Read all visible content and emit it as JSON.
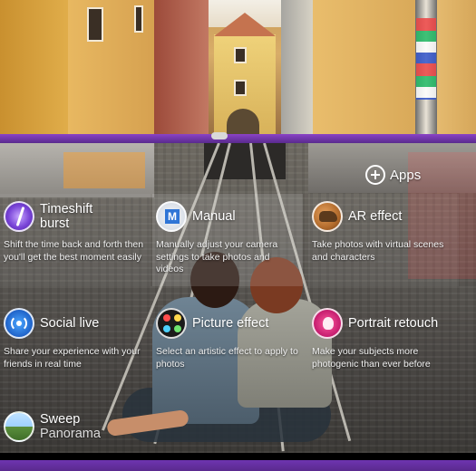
{
  "apps": {
    "label": "Apps"
  },
  "tiles": [
    {
      "title1": "Timeshift",
      "title2": "burst",
      "desc": "Shift the time back and forth then you'll get the best moment easily",
      "icon": "timeshift-icon"
    },
    {
      "title1": "Manual",
      "title2": "",
      "desc": "Manually adjust your camera settings to take photos and videos",
      "icon": "manual-icon"
    },
    {
      "title1": "AR effect",
      "title2": "",
      "desc": "Take photos with virtual scenes and characters",
      "icon": "ar-effect-icon"
    },
    {
      "title1": "Social live",
      "title2": "",
      "desc": "Share your experience with your friends in real time",
      "icon": "social-live-icon"
    },
    {
      "title1": "Picture effect",
      "title2": "",
      "desc": "Select an artistic effect to apply to photos",
      "icon": "picture-effect-icon"
    },
    {
      "title1": "Portrait retouch",
      "title2": "",
      "desc": "Make your subjects more photogenic than ever before",
      "icon": "portrait-retouch-icon"
    },
    {
      "title1": "Sweep",
      "title2": "Panorama",
      "desc": "",
      "icon": "sweep-panorama-icon"
    }
  ],
  "colors": {
    "accent": "#7a3fc0"
  }
}
